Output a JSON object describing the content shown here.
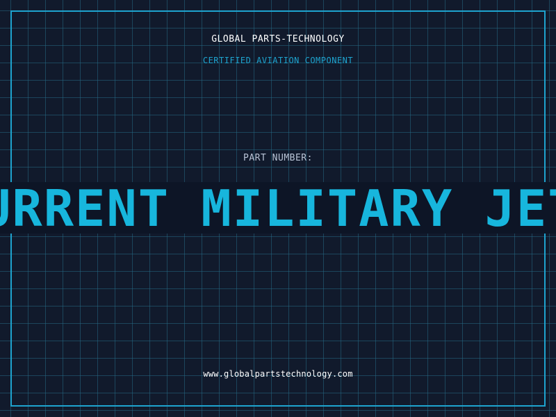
{
  "company": {
    "name": "GLOBAL PARTS-TECHNOLOGY",
    "tagline": "CERTIFIED AVIATION COMPONENT"
  },
  "part": {
    "label": "PART NUMBER:",
    "value": "URRENT MILITARY JET"
  },
  "footer": {
    "url": "www.globalpartstechnology.com"
  },
  "colors": {
    "background": "#111a2c",
    "accent": "#1ea4cf",
    "text": "#ffffff"
  }
}
